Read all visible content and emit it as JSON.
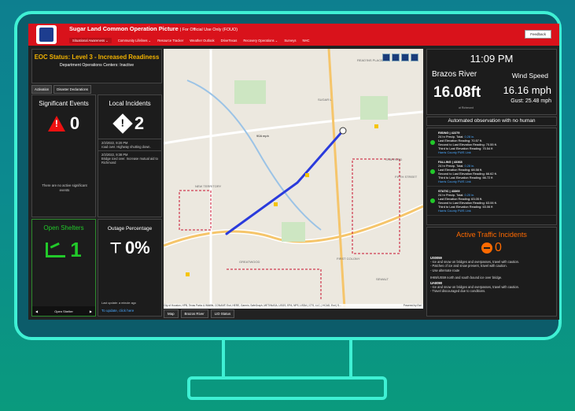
{
  "app": {
    "title": "Sugar Land Common Operation Picture",
    "subtitle": "| For Official Use Only (FOUO)",
    "feedback_label": "Feedback"
  },
  "nav": {
    "items": [
      {
        "label": "Situational Awareness ⌄",
        "active": true
      },
      {
        "label": "Community Lifelines ⌄"
      },
      {
        "label": "Resource Tracker"
      },
      {
        "label": "Weather Outlook"
      },
      {
        "label": "DriveTexas"
      },
      {
        "label": "Recovery Operations ⌄"
      },
      {
        "label": "Surveys"
      },
      {
        "label": "NHC"
      }
    ]
  },
  "eoc": {
    "status": "EOC Status: Level 3 - Increased Readiness",
    "dept": "Department Operations Centers: Inactive",
    "tabs": [
      "Activation",
      "Disaster Declarations"
    ]
  },
  "significant_events": {
    "title": "Significant Events",
    "count": "0",
    "empty_text": "There are no active significant events"
  },
  "local_incidents": {
    "title": "Local Incidents",
    "count": "2",
    "items": [
      {
        "time": "2/3/2022, 9:20 PM",
        "text": "road over. Highway shutting down."
      },
      {
        "time": "2/3/2022, 9:38 PM",
        "text": "Bridge iced over. Increase mutual aid to Richmond"
      }
    ]
  },
  "shelters": {
    "title": "Open Shelters",
    "count": "1",
    "nav_label": "Open Shelter"
  },
  "outage": {
    "title": "Outage Percentage",
    "value": "0%",
    "update": "Last update: a minute ago",
    "link": "To update, click here"
  },
  "map": {
    "attribution": "City of Houston, HPB, Texas Parks & Wildlife, CONANP, Esri, HERE, Garmin, SafeGraph, METI/NASA, USGS, EPA, NPS, USDA | CTS, LLC, | HCAD, Esri | S...",
    "powered": "Powered by Esri",
    "labels": [
      "READ'INS PLACE",
      "SUGAR L",
      "STAFFORD",
      "FIFTH STREET",
      "NEW TERRITORY",
      "FIRST COLONY",
      "GREATWOOD",
      "SEWALT"
    ],
    "marker_label": "90A mph",
    "tabs": [
      "Map",
      "Brazos River",
      "LID Status"
    ]
  },
  "weather": {
    "time": "11:09 PM",
    "river_name": "Brazos River",
    "river_level": "16.08ft",
    "river_sub": "at Richmond",
    "wind_title": "Wind Speed",
    "wind_speed": "16.16 mph",
    "wind_gust": "Gust: 25.48 mph"
  },
  "auto_observation": "Automated observation with no human",
  "gauges": [
    {
      "title": "RISING | 42279",
      "precip": "24 hr Precip. Total:",
      "precip_val": "0.28 in.",
      "last": "Last Elevation Reading: 70.57 ft.",
      "second": "Second to Last Elevation Reading: 70.55 ft.",
      "third": "Third to Last Elevation Reading: 70.54 ft",
      "link": "Harris County FWS Link"
    },
    {
      "title": "FALLING | 43368",
      "precip": "24 hr Precip. Total:",
      "precip_val": "0.28 in.",
      "last": "Last Elevation Reading: 68.58 ft.",
      "second": "Second to Last Elevation Reading: 66.62 ft.",
      "third": "Third to Last Elevation Reading: 66.72 ft",
      "link": "Harris County FWS Link"
    },
    {
      "title": "STATIC | 43369",
      "precip": "24 hr Precip. Total:",
      "precip_val": "0.20 in.",
      "last": "Last Elevation Reading: 63.05 ft.",
      "second": "Second to Last Elevation Reading: 63.06 ft.",
      "third": "Third to Last Elevation Reading: 63.06 ft",
      "link": "Harris County FWS Link"
    }
  ],
  "traffic": {
    "title": "Active Traffic Incidents",
    "count": "0",
    "items": [
      {
        "route": "US0059",
        "lines": [
          "- Ice and snow on bridges and overpasses, travel with caution.",
          "- Patches of ice and snow present, travel with caution.",
          "- Use alternate route",
          "",
          "IH69/US59 north and south bound ice over bridge."
        ]
      },
      {
        "route": "UA0090",
        "lines": [
          "- Ice and snow on bridges and overpasses, travel with caution.",
          "- Travel discouraged due to conditions."
        ]
      }
    ]
  },
  "colors": {
    "header_red": "#d9121b",
    "eoc_gold": "#f3b300",
    "shelter_green": "#22c92a",
    "traffic_orange": "#ff6a00",
    "link_blue": "#4aa8ff"
  }
}
